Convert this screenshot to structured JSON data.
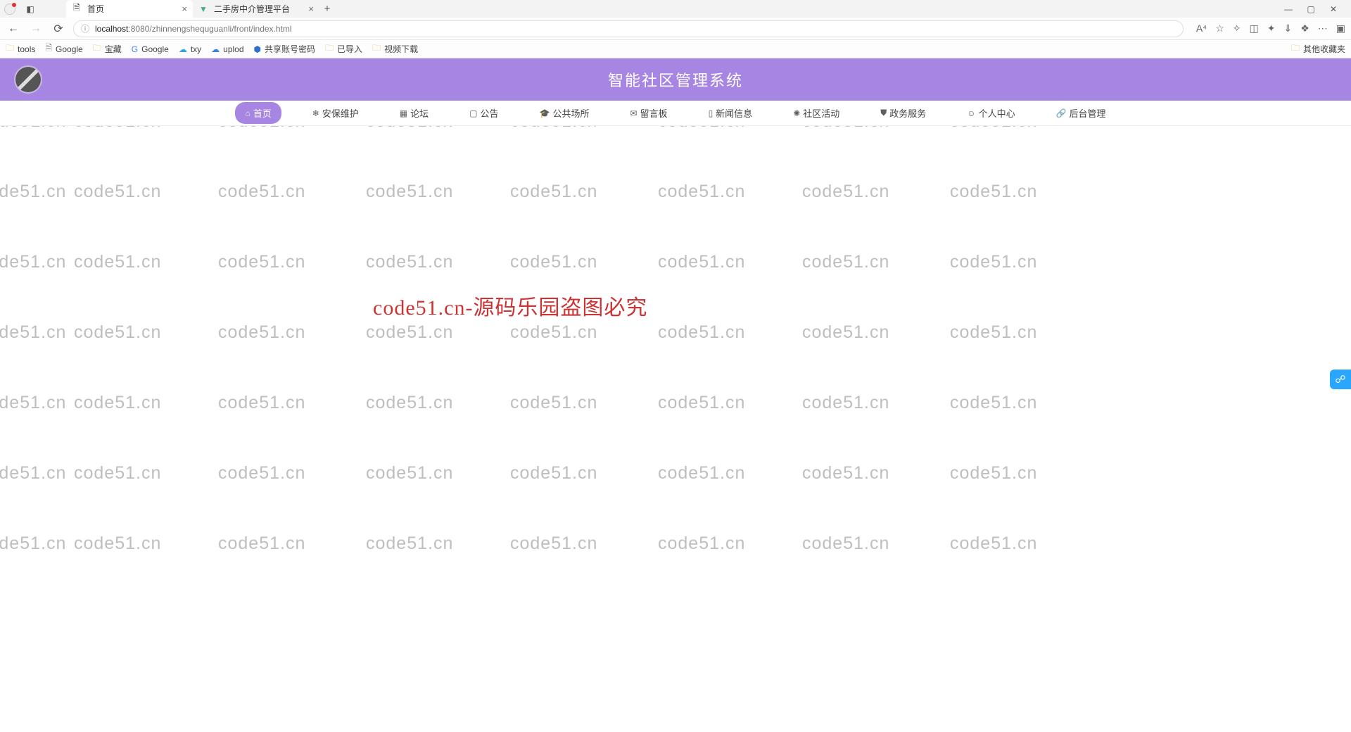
{
  "browser": {
    "tabs": [
      {
        "title": "首页",
        "active": true,
        "favicon": "page"
      },
      {
        "title": "二手房中介管理平台",
        "active": false,
        "favicon": "vue"
      }
    ],
    "url_host": "localhost",
    "url_port": ":8080",
    "url_path": "/zhinnengshequguanli/front/index.html",
    "bookmarks": [
      {
        "label": "tools",
        "type": "folder"
      },
      {
        "label": "Google",
        "type": "page"
      },
      {
        "label": "宝藏",
        "type": "folder"
      },
      {
        "label": "Google",
        "type": "g"
      },
      {
        "label": "txy",
        "type": "cloud"
      },
      {
        "label": "uplod",
        "type": "cloud2"
      },
      {
        "label": "共享账号密码",
        "type": "app"
      },
      {
        "label": "已导入",
        "type": "folder"
      },
      {
        "label": "视频下载",
        "type": "folder"
      }
    ],
    "bookmarks_other": "其他收藏夹"
  },
  "page": {
    "hero_title": "智能社区管理系统",
    "nav": [
      {
        "icon": "⌂",
        "label": "首页",
        "active": true
      },
      {
        "icon": "❄",
        "label": "安保维护"
      },
      {
        "icon": "▦",
        "label": "论坛"
      },
      {
        "icon": "▢",
        "label": "公告"
      },
      {
        "icon": "🎓",
        "label": "公共场所"
      },
      {
        "icon": "✉",
        "label": "留言板"
      },
      {
        "icon": "▯",
        "label": "新闻信息"
      },
      {
        "icon": "✺",
        "label": "社区活动"
      },
      {
        "icon": "⛊",
        "label": "政务服务"
      },
      {
        "icon": "☺",
        "label": "个人中心"
      },
      {
        "icon": "🔗",
        "label": "后台管理"
      }
    ]
  },
  "watermark": {
    "text": "code51.cn",
    "center_text": "code51.cn-源码乐园盗图必究"
  }
}
